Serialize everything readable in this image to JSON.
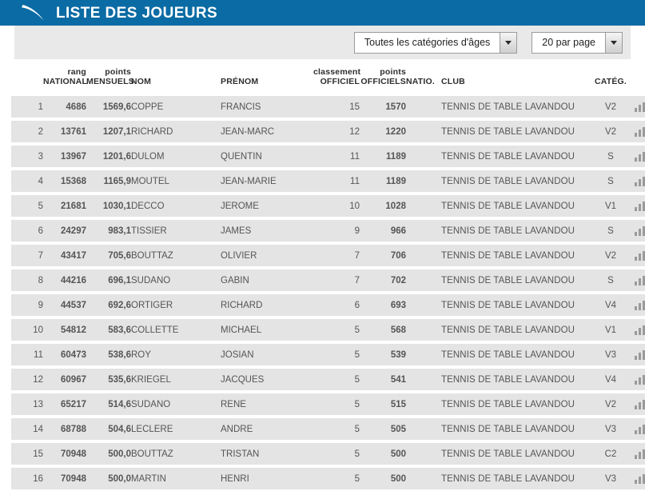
{
  "header": {
    "title": "LISTE DES JOUEURS",
    "logo_icon": "swoosh-icon",
    "bar_color": "#0b6ba4"
  },
  "toolbar": {
    "age_category_select": {
      "value": "Toutes les catégories d'âges",
      "arrow_icon": "chevron-down-icon"
    },
    "page_size_select": {
      "value": "20 par page",
      "arrow_icon": "chevron-down-icon"
    }
  },
  "table": {
    "columns": {
      "index": "",
      "rang_national": "rang\nNATIONAL",
      "points_mensuels": "points\nMENSUELS",
      "nom": "NOM",
      "prenom": "PRÉNOM",
      "classement_officiel": "classement\nOFFICIEL",
      "points_officiels": "points\nOFFICIELS",
      "natio": "NATIO.",
      "club": "CLUB",
      "categ": "CATÉG.",
      "stats": ""
    },
    "accent_color": "#186a9e",
    "rows": [
      {
        "idx": "1",
        "rang": "4686",
        "pts_mensuels": "1569,6",
        "nom": "COPPE",
        "prenom": "FRANCIS",
        "classement": "15",
        "pts_officiels": "1570",
        "natio": "",
        "club": "TENNIS DE TABLE LAVANDOU",
        "categ": "V2",
        "stats_icon": "bar-chart-icon"
      },
      {
        "idx": "2",
        "rang": "13761",
        "pts_mensuels": "1207,1",
        "nom": "RICHARD",
        "prenom": "JEAN-MARC",
        "classement": "12",
        "pts_officiels": "1220",
        "natio": "",
        "club": "TENNIS DE TABLE LAVANDOU",
        "categ": "V2",
        "stats_icon": "bar-chart-icon"
      },
      {
        "idx": "3",
        "rang": "13967",
        "pts_mensuels": "1201,6",
        "nom": "DULOM",
        "prenom": "QUENTIN",
        "classement": "11",
        "pts_officiels": "1189",
        "natio": "",
        "club": "TENNIS DE TABLE LAVANDOU",
        "categ": "S",
        "stats_icon": "bar-chart-icon"
      },
      {
        "idx": "4",
        "rang": "15368",
        "pts_mensuels": "1165,9",
        "nom": "MOUTEL",
        "prenom": "JEAN-MARIE",
        "classement": "11",
        "pts_officiels": "1189",
        "natio": "",
        "club": "TENNIS DE TABLE LAVANDOU",
        "categ": "S",
        "stats_icon": "bar-chart-icon"
      },
      {
        "idx": "5",
        "rang": "21681",
        "pts_mensuels": "1030,1",
        "nom": "DECCO",
        "prenom": "JEROME",
        "classement": "10",
        "pts_officiels": "1028",
        "natio": "",
        "club": "TENNIS DE TABLE LAVANDOU",
        "categ": "V1",
        "stats_icon": "bar-chart-icon"
      },
      {
        "idx": "6",
        "rang": "24297",
        "pts_mensuels": "983,1",
        "nom": "TISSIER",
        "prenom": "JAMES",
        "classement": "9",
        "pts_officiels": "966",
        "natio": "",
        "club": "TENNIS DE TABLE LAVANDOU",
        "categ": "S",
        "stats_icon": "bar-chart-icon"
      },
      {
        "idx": "7",
        "rang": "43417",
        "pts_mensuels": "705,6",
        "nom": "BOUTTAZ",
        "prenom": "OLIVIER",
        "classement": "7",
        "pts_officiels": "706",
        "natio": "",
        "club": "TENNIS DE TABLE LAVANDOU",
        "categ": "V2",
        "stats_icon": "bar-chart-icon"
      },
      {
        "idx": "8",
        "rang": "44216",
        "pts_mensuels": "696,1",
        "nom": "SUDANO",
        "prenom": "GABIN",
        "classement": "7",
        "pts_officiels": "702",
        "natio": "",
        "club": "TENNIS DE TABLE LAVANDOU",
        "categ": "S",
        "stats_icon": "bar-chart-icon"
      },
      {
        "idx": "9",
        "rang": "44537",
        "pts_mensuels": "692,6",
        "nom": "ORTIGER",
        "prenom": "RICHARD",
        "classement": "6",
        "pts_officiels": "693",
        "natio": "",
        "club": "TENNIS DE TABLE LAVANDOU",
        "categ": "V4",
        "stats_icon": "bar-chart-icon"
      },
      {
        "idx": "10",
        "rang": "54812",
        "pts_mensuels": "583,6",
        "nom": "COLLETTE",
        "prenom": "MICHAEL",
        "classement": "5",
        "pts_officiels": "568",
        "natio": "",
        "club": "TENNIS DE TABLE LAVANDOU",
        "categ": "V1",
        "stats_icon": "bar-chart-icon"
      },
      {
        "idx": "11",
        "rang": "60473",
        "pts_mensuels": "538,6",
        "nom": "ROY",
        "prenom": "JOSIAN",
        "classement": "5",
        "pts_officiels": "539",
        "natio": "",
        "club": "TENNIS DE TABLE LAVANDOU",
        "categ": "V3",
        "stats_icon": "bar-chart-icon"
      },
      {
        "idx": "12",
        "rang": "60967",
        "pts_mensuels": "535,6",
        "nom": "KRIEGEL",
        "prenom": "JACQUES",
        "classement": "5",
        "pts_officiels": "541",
        "natio": "",
        "club": "TENNIS DE TABLE LAVANDOU",
        "categ": "V4",
        "stats_icon": "bar-chart-icon"
      },
      {
        "idx": "13",
        "rang": "65217",
        "pts_mensuels": "514,6",
        "nom": "SUDANO",
        "prenom": "RENE",
        "classement": "5",
        "pts_officiels": "515",
        "natio": "",
        "club": "TENNIS DE TABLE LAVANDOU",
        "categ": "V2",
        "stats_icon": "bar-chart-icon"
      },
      {
        "idx": "14",
        "rang": "68788",
        "pts_mensuels": "504,6",
        "nom": "LECLERE",
        "prenom": "ANDRE",
        "classement": "5",
        "pts_officiels": "505",
        "natio": "",
        "club": "TENNIS DE TABLE LAVANDOU",
        "categ": "V3",
        "stats_icon": "bar-chart-icon"
      },
      {
        "idx": "15",
        "rang": "70948",
        "pts_mensuels": "500,0",
        "nom": "BOUTTAZ",
        "prenom": "TRISTAN",
        "classement": "5",
        "pts_officiels": "500",
        "natio": "",
        "club": "TENNIS DE TABLE LAVANDOU",
        "categ": "C2",
        "stats_icon": "bar-chart-icon"
      },
      {
        "idx": "16",
        "rang": "70948",
        "pts_mensuels": "500,0",
        "nom": "MARTIN",
        "prenom": "HENRI",
        "classement": "5",
        "pts_officiels": "500",
        "natio": "",
        "club": "TENNIS DE TABLE LAVANDOU",
        "categ": "V3",
        "stats_icon": "bar-chart-icon"
      }
    ]
  }
}
